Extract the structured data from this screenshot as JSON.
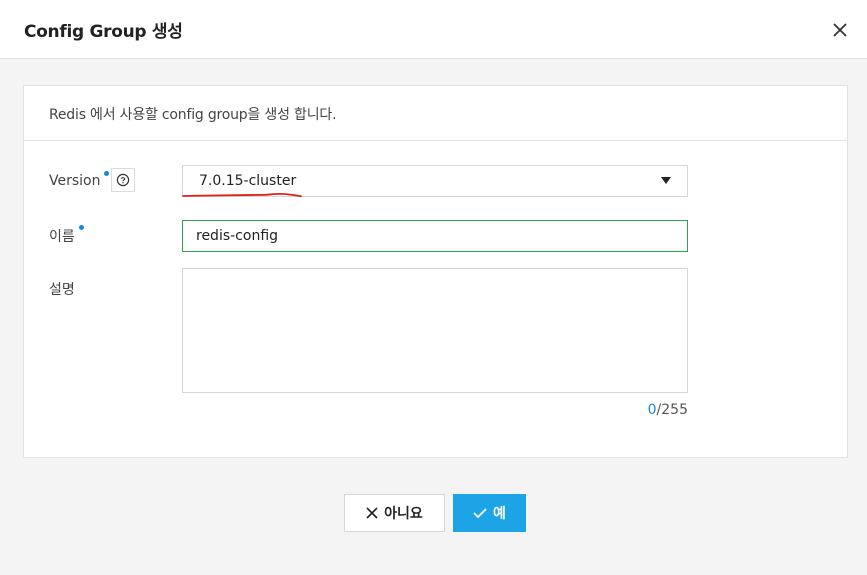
{
  "dialog": {
    "title": "Config Group 생성",
    "description": "Redis 에서 사용할 config group을 생성 합니다."
  },
  "form": {
    "version_label": "Version",
    "version_value": "7.0.15-cluster",
    "name_label": "이름",
    "name_value": "redis-config",
    "desc_label": "설명",
    "desc_value": "",
    "counter_current": "0",
    "counter_max": "/255"
  },
  "buttons": {
    "no_label": "아니요",
    "yes_label": "예"
  },
  "colors": {
    "accent": "#1ca4e6",
    "required_dot": "#1b87d6",
    "input_focus_border": "#2ea44f",
    "annotation_red": "#e0211b"
  },
  "icons": [
    "close-icon",
    "help-icon",
    "dropdown-arrow-icon",
    "x-icon",
    "check-icon"
  ]
}
